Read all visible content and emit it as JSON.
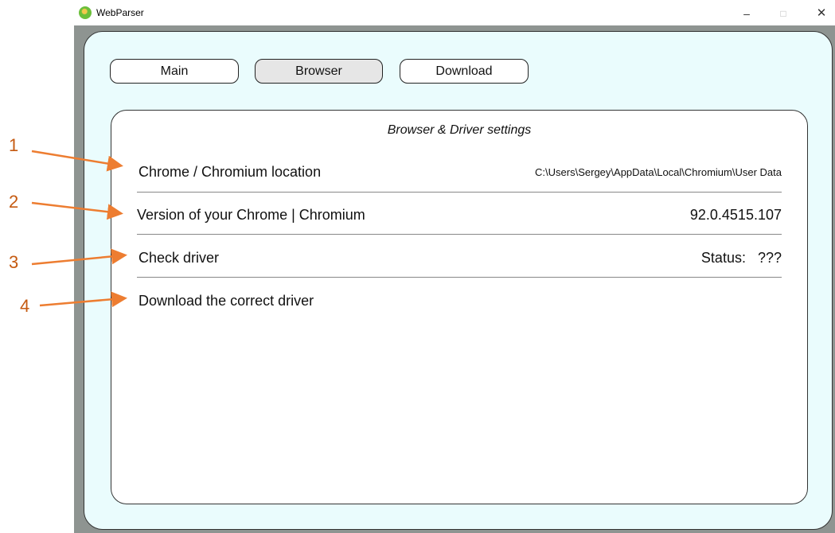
{
  "window": {
    "title": "WebParser",
    "controls": {
      "minimize": "–",
      "maximize": "□",
      "close": "✕"
    }
  },
  "tabs": [
    {
      "label": "Main"
    },
    {
      "label": "Browser",
      "selected": true
    },
    {
      "label": "Download"
    }
  ],
  "settings": {
    "title": "Browser & Driver settings",
    "rows": [
      {
        "label": "Chrome / Chromium location",
        "value": "C:\\Users\\Sergey\\AppData\\Local\\Chromium\\User Data"
      },
      {
        "label": "Version of your Chrome | Chromium",
        "value": "92.0.4515.107"
      },
      {
        "label": "Check driver",
        "value": "Status:   ???"
      },
      {
        "label": "Download the correct driver",
        "value": ""
      }
    ]
  },
  "annotations": [
    "1",
    "2",
    "3",
    "4"
  ],
  "colors": {
    "panel": "#eafcfd",
    "frame": "#8e9491",
    "annotation": "#ed7d31",
    "selected_tab": "#e6e6e6"
  }
}
